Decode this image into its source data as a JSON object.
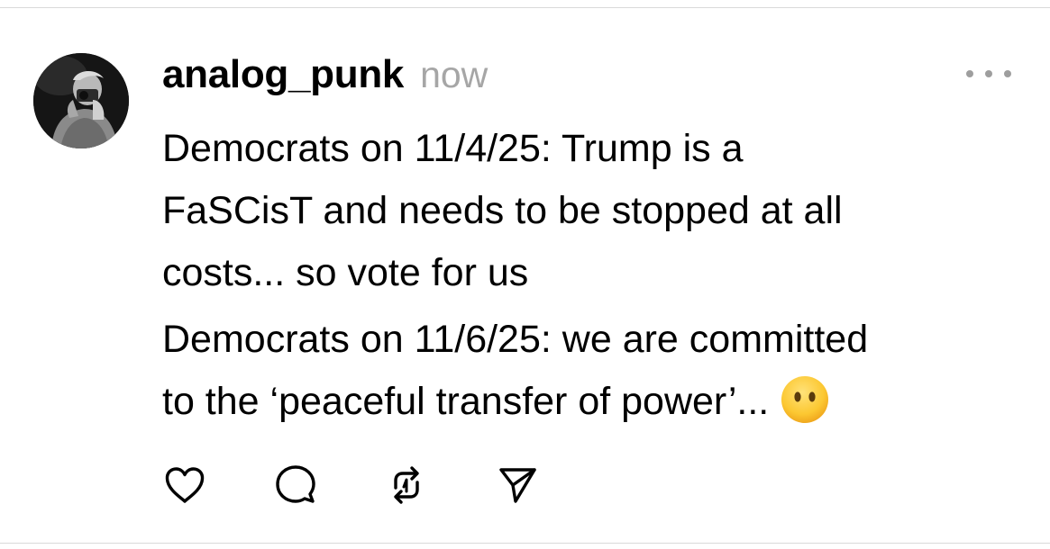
{
  "post": {
    "author": {
      "username": "analog_punk",
      "avatar_icon": "avatar-photo"
    },
    "timestamp": "now",
    "body": {
      "paragraph1_lines": [
        "Democrats on 11/4/25: Trump is a",
        "FaSCisT and needs to be stopped at all",
        "costs... so vote for us"
      ],
      "paragraph2_lines": [
        "Democrats on 11/6/25: we are committed",
        "to the ‘peaceful transfer of power’..."
      ],
      "emoji": "face-without-mouth"
    },
    "actions": {
      "like_icon": "heart-icon",
      "reply_icon": "comment-icon",
      "repost_icon": "repost-icon",
      "share_icon": "send-icon"
    },
    "menu_icon": "more-icon"
  },
  "colors": {
    "text": "#000000",
    "timestamp": "#a6a6a6",
    "icon": "#000000",
    "divider": "#d9d9d9",
    "emoji_face": "#ffcc33"
  }
}
